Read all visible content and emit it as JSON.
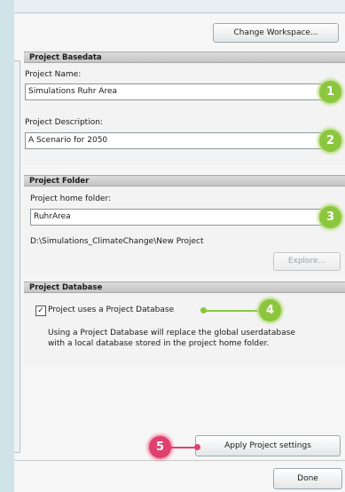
{
  "toolbar": {
    "change_workspace": "Change Workspace..."
  },
  "basedata": {
    "header": "Project Basedata",
    "name_label": "Project Name:",
    "name_value": "Simulations Ruhr Area",
    "desc_label": "Project Description:",
    "desc_value": "A Scenario for 2050"
  },
  "folder": {
    "header": "Project Folder",
    "home_label": "Project home folder:",
    "home_value": "RuhrArea",
    "path": "D:\\Simulations_ClimateChange\\New Project",
    "explore": "Explore..."
  },
  "database": {
    "header": "Project Database",
    "checkbox_label": "Project uses a Project Database",
    "checked": true,
    "info_line1": "Using a Project Database will replace the global userdatabase",
    "info_line2": "with a local database stored in the project home folder."
  },
  "actions": {
    "apply": "Apply Project settings",
    "done": "Done"
  },
  "callouts": {
    "c1": "1",
    "c2": "2",
    "c3": "3",
    "c4": "4",
    "c5": "5"
  },
  "colors": {
    "callout_green": "#8cc63f",
    "callout_pink": "#e0406e",
    "background": "#cfe3e8"
  }
}
